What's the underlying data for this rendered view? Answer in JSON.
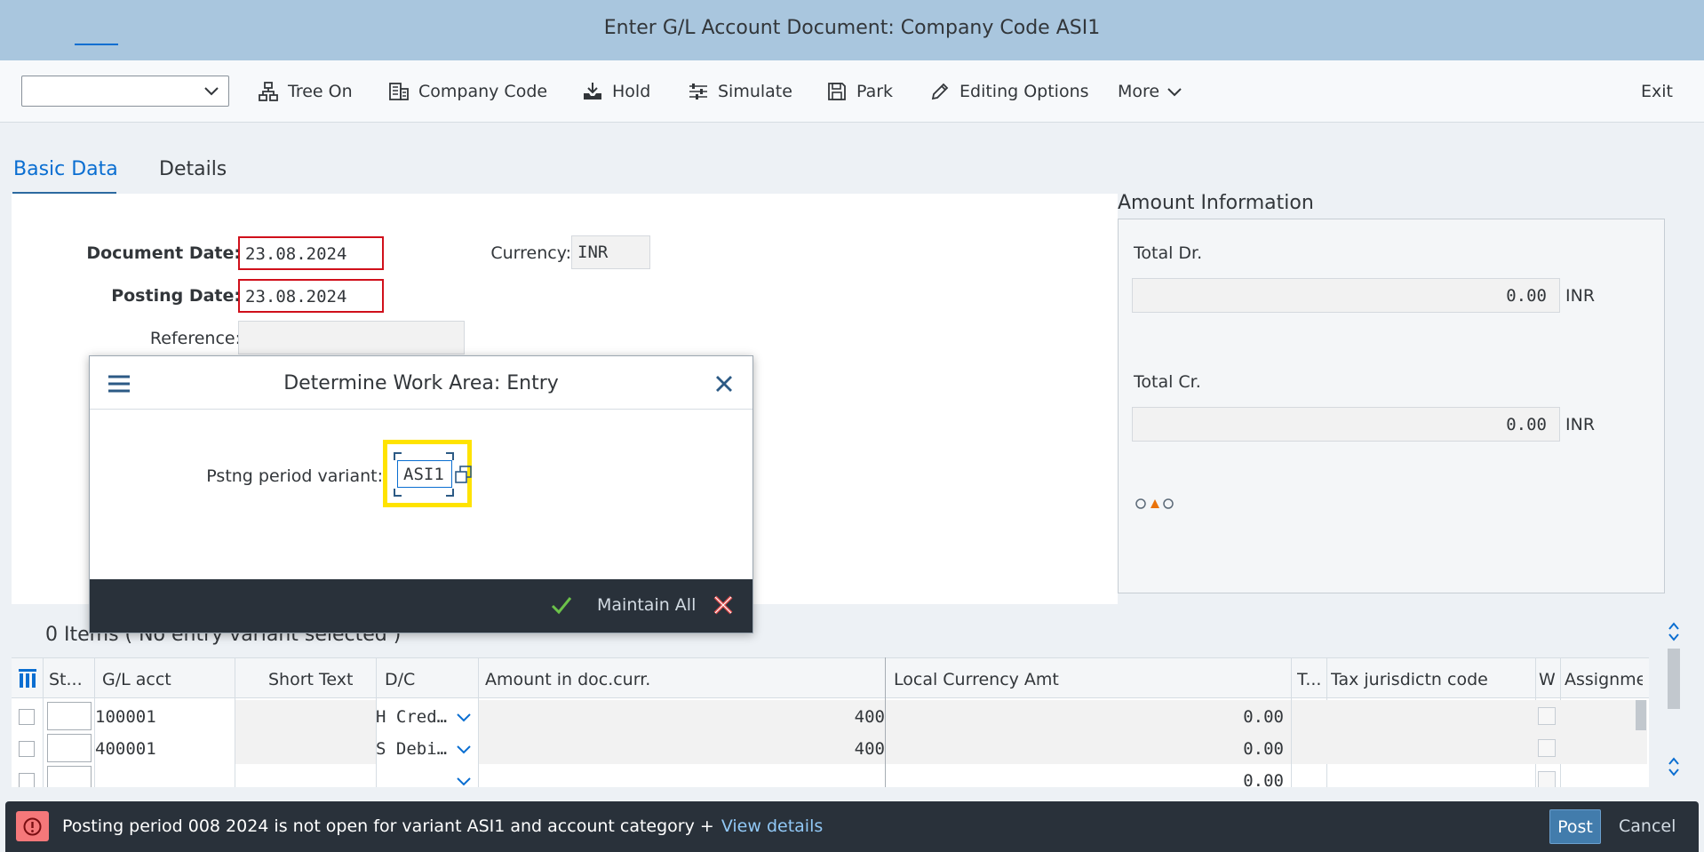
{
  "window": {
    "title": "Enter G/L Account Document: Company Code ASI1"
  },
  "toolbar": {
    "select_value": "",
    "tree_on": "Tree On",
    "company_code": "Company Code",
    "hold": "Hold",
    "simulate": "Simulate",
    "park": "Park",
    "editing_options": "Editing Options",
    "more": "More",
    "exit": "Exit"
  },
  "tabs": {
    "basic": "Basic Data",
    "details": "Details"
  },
  "form": {
    "doc_date_label": "Document Date:",
    "doc_date": "23.08.2024",
    "posting_date_label": "Posting Date:",
    "posting_date": "23.08.2024",
    "reference_label": "Reference:",
    "reference": "",
    "currency_label": "Currency:",
    "currency": "INR"
  },
  "amount_info": {
    "title": "Amount Information",
    "total_dr_label": "Total Dr.",
    "total_dr": "0.00",
    "total_cr_label": "Total Cr.",
    "total_cr": "0.00",
    "currency": "INR"
  },
  "items": {
    "title": "0 Items ( No entry variant selected )",
    "headers": {
      "st": "St...",
      "gl_acct": "G/L acct",
      "short_text": "Short Text",
      "dc": "D/C",
      "amount_doc": "Amount in doc.curr.",
      "local_amt": "Local Currency Amt",
      "t": "T...",
      "tax_juris": "Tax jurisdictn code",
      "w": "W",
      "assignment": "Assignme"
    },
    "rows": [
      {
        "gl_acct": "100001",
        "dc": "H Cred…",
        "amount_doc": "400",
        "local_amt": "0.00"
      },
      {
        "gl_acct": "400001",
        "dc": "S Debi…",
        "amount_doc": "400",
        "local_amt": "0.00"
      },
      {
        "gl_acct": "",
        "dc": "",
        "amount_doc": "",
        "local_amt": "0.00"
      }
    ]
  },
  "dialog": {
    "title": "Determine Work Area: Entry",
    "field_label": "Pstng period variant:",
    "field_value": "ASI1",
    "maintain_all": "Maintain All"
  },
  "message": {
    "text": "Posting period 008 2024 is not open for variant ASI1 and account category +",
    "link": "View details",
    "post": "Post",
    "cancel": "Cancel"
  },
  "colors": {
    "titlebar": "#a9c6de",
    "accent": "#0a6ed1",
    "error": "#d0101b",
    "highlight": "#ffe300",
    "footer": "#29313a"
  }
}
